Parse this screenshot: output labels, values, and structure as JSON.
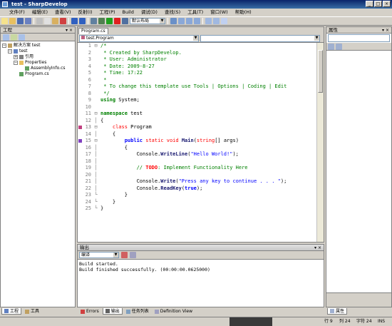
{
  "window": {
    "title": "test - SharpDevelop"
  },
  "menu": [
    "文件(F)",
    "编辑(E)",
    "查看(V)",
    "反射(I)",
    "工程(P)",
    "Build",
    "调试(D)",
    "查找(S)",
    "工具(T)",
    "窗口(W)",
    "帮助(H)"
  ],
  "toolbar": {
    "config_combo": "默认布局"
  },
  "project_panel": {
    "title": "工程",
    "tree": {
      "solution": "解决方案 test",
      "project": "test",
      "references": "引用",
      "properties": "Properties",
      "assemblyinfo": "AssemblyInfo.cs",
      "program": "Program.cs"
    }
  },
  "editor": {
    "tab": "Program.cs",
    "class_combo": "test.Program",
    "member_combo": "",
    "lines": [
      {
        "n": "1",
        "h": "<span class='cm'>/*</span>"
      },
      {
        "n": "2",
        "h": "<span class='cm'> * Created by SharpDevelop.</span>"
      },
      {
        "n": "3",
        "h": "<span class='cm'> * User: Administrator</span>"
      },
      {
        "n": "4",
        "h": "<span class='cm'> * Date: 2009-8-27</span>"
      },
      {
        "n": "5",
        "h": "<span class='cm'> * Time: 17:22</span>"
      },
      {
        "n": "6",
        "h": "<span class='cm'> *</span>"
      },
      {
        "n": "7",
        "h": "<span class='cm'> * To change this template use Tools | Options | Coding | Edit</span>"
      },
      {
        "n": "8",
        "h": "<span class='cm'> */</span>"
      },
      {
        "n": "9",
        "h": "<span class='kw'>using</span> System;"
      },
      {
        "n": "10",
        "h": ""
      },
      {
        "n": "11",
        "h": "<span class='kw'>namespace</span> test"
      },
      {
        "n": "12",
        "h": "{"
      },
      {
        "n": "13",
        "h": "    <span class='kr'>class</span> Program"
      },
      {
        "n": "14",
        "h": "    {"
      },
      {
        "n": "15",
        "h": "        <span class='kb'>public</span> <span class='kr'>static</span> <span class='kr'>void</span> <span class='mth'>Main</span>(<span class='kr'>string</span>[] args)"
      },
      {
        "n": "16",
        "h": "        {"
      },
      {
        "n": "17",
        "h": "            Console.<span class='mth'>WriteLine</span>(<span class='str'>\"Hello World!\"</span>);"
      },
      {
        "n": "18",
        "h": ""
      },
      {
        "n": "19",
        "h": "            <span class='cm'>// </span><span class='todo'>TODO</span><span class='cm'>: Implement Functionality Here</span>"
      },
      {
        "n": "20",
        "h": ""
      },
      {
        "n": "21",
        "h": "            Console.<span class='mth'>Write</span>(<span class='str'>\"Press any key to continue . . . \"</span>);"
      },
      {
        "n": "22",
        "h": "            Console.<span class='mth'>ReadKey</span>(<span class='kb'>true</span>);"
      },
      {
        "n": "23",
        "h": "        }"
      },
      {
        "n": "24",
        "h": "    }"
      },
      {
        "n": "25",
        "h": "}"
      }
    ]
  },
  "output_panel": {
    "title": "输出",
    "combo": "编译",
    "lines": [
      "Build started.",
      "Build finished successfully. (00:00:00.0625000)"
    ]
  },
  "properties_panel": {
    "title": "属性"
  },
  "bottom_tabs": {
    "left": [
      "工程",
      "工具"
    ],
    "mid": [
      "Errors",
      "输出",
      "任务列表",
      "Definition View"
    ],
    "right": [
      "属性"
    ]
  },
  "status": {
    "line": "行 9",
    "col": "列 24",
    "char": "字符 24",
    "ins": "INS"
  }
}
